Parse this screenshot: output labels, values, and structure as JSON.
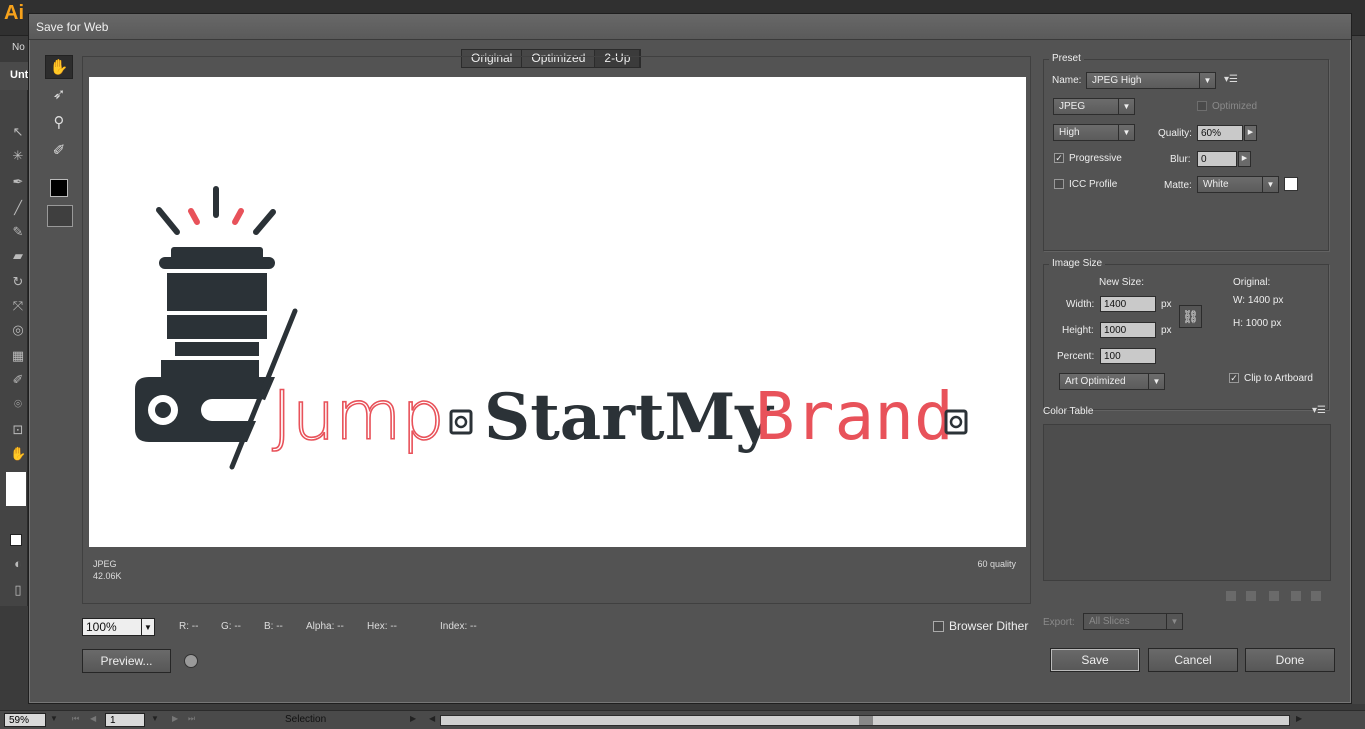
{
  "background_app": {
    "logo": "Ai",
    "control_label": "No",
    "doc_tab": "Unt",
    "status": {
      "zoom": "59%",
      "artboard": "1",
      "tool": "Selection"
    }
  },
  "dialog": {
    "title": "Save for Web",
    "view_tabs": [
      {
        "label": "Original",
        "selected": false
      },
      {
        "label": "Optimized",
        "selected": false
      },
      {
        "label": "2-Up",
        "selected": true
      }
    ],
    "artwork": {
      "word1": "Jump",
      "word2": "StartMy",
      "word3": "Brand",
      "colors": {
        "dark": "#2b3237",
        "accent": "#e8525a"
      }
    },
    "preview_info": {
      "format": "JPEG",
      "size": "42.06K",
      "quality": "60 quality"
    },
    "zoom": "100%",
    "readouts": {
      "r": "R: --",
      "g": "G: --",
      "b": "B: --",
      "alpha": "Alpha: --",
      "hex": "Hex: --",
      "index": "Index: --"
    },
    "browser_dither": "Browser Dither",
    "preview_button": "Preview...",
    "preset": {
      "group_title": "Preset",
      "name_label": "Name:",
      "name_value": "JPEG High",
      "format_value": "JPEG",
      "optimized_label": "Optimized",
      "quality_preset": "High",
      "quality_label": "Quality:",
      "quality_value": "60%",
      "progressive_label": "Progressive",
      "blur_label": "Blur:",
      "blur_value": "0",
      "icc_label": "ICC Profile",
      "matte_label": "Matte:",
      "matte_value": "White"
    },
    "image_size": {
      "group_title": "Image Size",
      "new_size_label": "New Size:",
      "width_label": "Width:",
      "width_value": "1400",
      "height_label": "Height:",
      "height_value": "1000",
      "unit": "px",
      "percent_label": "Percent:",
      "percent_value": "100",
      "original_label": "Original:",
      "orig_w": "W:  1400 px",
      "orig_h": "H:  1000 px",
      "resample": "Art Optimized",
      "clip_label": "Clip to Artboard"
    },
    "color_table": {
      "title": "Color Table"
    },
    "export": {
      "label": "Export:",
      "value": "All Slices"
    },
    "buttons": {
      "save": "Save",
      "cancel": "Cancel",
      "done": "Done"
    }
  }
}
